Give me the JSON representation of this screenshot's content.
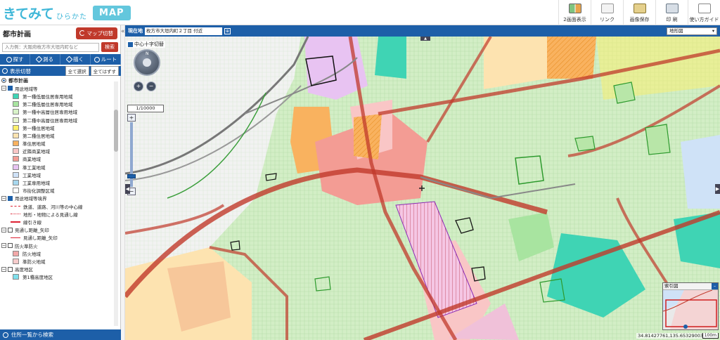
{
  "header": {
    "logo_main": "きてみて",
    "logo_sub": "ひらかた",
    "logo_tag": "MAP",
    "tools": [
      {
        "label": "2画面表示",
        "icon": "dual-screen-icon"
      },
      {
        "label": "リンク",
        "icon": "link-icon"
      },
      {
        "label": "画像保存",
        "icon": "image-save-icon"
      },
      {
        "label": "印 刷",
        "icon": "print-icon"
      },
      {
        "label": "使い方ガイド",
        "icon": "guide-icon"
      }
    ]
  },
  "sidebar": {
    "title": "都市計画",
    "map_switch_label": "マップ切替",
    "search_placeholder": "入力例：大阪府枚方市大垣内町など",
    "search_button": "検索",
    "tools": [
      {
        "label": "探す",
        "icon": "search-icon"
      },
      {
        "label": "測る",
        "icon": "ruler-icon"
      },
      {
        "label": "描く",
        "icon": "pen-icon"
      },
      {
        "label": "ルート",
        "icon": "route-icon"
      }
    ],
    "display_toggle": "表示切替",
    "select_all": "全て選択",
    "deselect_all": "全てはずす",
    "footer": "住所一覧から検索"
  },
  "legend": {
    "root": "都市計画",
    "groups": [
      {
        "title": "用途地域等",
        "items": [
          {
            "label": "第一種低層住居専用地域",
            "color": "#3fd4b4"
          },
          {
            "label": "第二種低層住居専用地域",
            "color": "#a8e4a0"
          },
          {
            "label": "第一種中高層住居専用地域",
            "color": "#d8f2c8"
          },
          {
            "label": "第二種中高層住居専用地域",
            "color": "#e8f5d0"
          },
          {
            "label": "第一種住居地域",
            "color": "#fdf06a"
          },
          {
            "label": "第二種住居地域",
            "color": "#fde3b0"
          },
          {
            "label": "準住居地域",
            "color": "#f9b25f"
          },
          {
            "label": "近隣商業地域",
            "color": "#f9c6c6"
          },
          {
            "label": "商業地域",
            "color": "#f39c94"
          },
          {
            "label": "準工業地域",
            "color": "#e8c3f2"
          },
          {
            "label": "工業地域",
            "color": "#cfe2f7"
          },
          {
            "label": "工業専用地域",
            "color": "#a7d7ee"
          },
          {
            "label": "市街化調整区域",
            "color": "#ffffff"
          }
        ]
      },
      {
        "title": "用途地域等境界",
        "items": [
          {
            "label": "鉄道、道路、河川等の中心線",
            "line": "dash"
          },
          {
            "label": "地形・地物による見通し線",
            "line": "dashdot"
          },
          {
            "label": "線引き線",
            "line": "solid"
          }
        ]
      },
      {
        "title": "見通し距離_矢印",
        "items": [
          {
            "label": "見通し距離_矢印",
            "line": "arrow"
          }
        ]
      },
      {
        "title": "防火準防火",
        "items": [
          {
            "label": "防火地域",
            "color": "#f2a8a8"
          },
          {
            "label": "準防火地域",
            "color": "#f7cccc"
          }
        ]
      },
      {
        "title": "高度地区",
        "items": [
          {
            "label": "第1種高度地区",
            "color": "#7fe0ec"
          }
        ]
      }
    ]
  },
  "map": {
    "location_label": "現在地",
    "location_value": "枚方市大垣内町２丁目 付近",
    "basemap_selected": "地形図",
    "center_cross_label": "中心十字切替",
    "scale_label": "1/10000",
    "nav_north": "N",
    "overview_title": "索引図",
    "coordinates": "34.81427761,135.65329003",
    "scale_bar": "100m"
  }
}
